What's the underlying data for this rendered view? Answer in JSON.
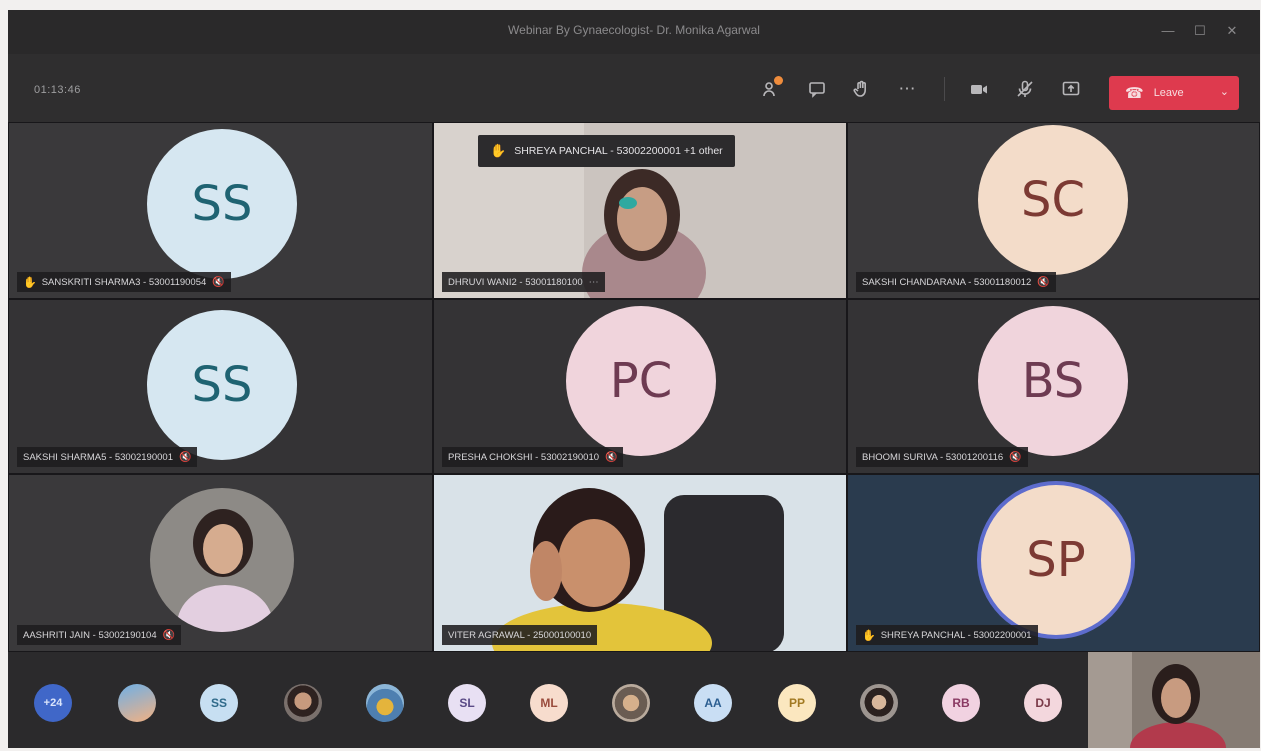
{
  "window": {
    "title": "Webinar By Gynaecologist- Dr. Monika Agarwal"
  },
  "toolbar": {
    "timer": "01:13:46",
    "leave_label": "Leave"
  },
  "banner": {
    "text": "SHREYA PANCHAL - 53002200001 +1 other"
  },
  "tiles": [
    {
      "initials": "SS",
      "name": "SANSKRITI SHARMA3 - 53001190054"
    },
    {
      "initials": "",
      "name": "DHRUVI WANI2 - 53001180100"
    },
    {
      "initials": "SC",
      "name": "SAKSHI CHANDARANA - 53001180012"
    },
    {
      "initials": "SS",
      "name": "SAKSHI SHARMA5 - 53002190001"
    },
    {
      "initials": "PC",
      "name": "PRESHA CHOKSHI - 53002190010"
    },
    {
      "initials": "BS",
      "name": "BHOOMI SURIVA - 53001200116"
    },
    {
      "initials": "",
      "name": "AASHRITI JAIN - 53002190104"
    },
    {
      "initials": "",
      "name": "VITER AGRAWAL - 25000100010"
    },
    {
      "initials": "SP",
      "name": "SHREYA PANCHAL - 53002200001"
    }
  ],
  "roster": {
    "overflow_count": "+24",
    "participants": [
      {
        "initials": ""
      },
      {
        "initials": "SS"
      },
      {
        "initials": ""
      },
      {
        "initials": ""
      },
      {
        "initials": "SL"
      },
      {
        "initials": "ML"
      },
      {
        "initials": ""
      },
      {
        "initials": "AA"
      },
      {
        "initials": "PP"
      },
      {
        "initials": ""
      },
      {
        "initials": "RB"
      },
      {
        "initials": "DJ"
      }
    ]
  },
  "colors": {
    "leave": "#de3a4e",
    "raise_hand": "#f1b43c",
    "active_speaker_ring": "#5d6ccd"
  }
}
